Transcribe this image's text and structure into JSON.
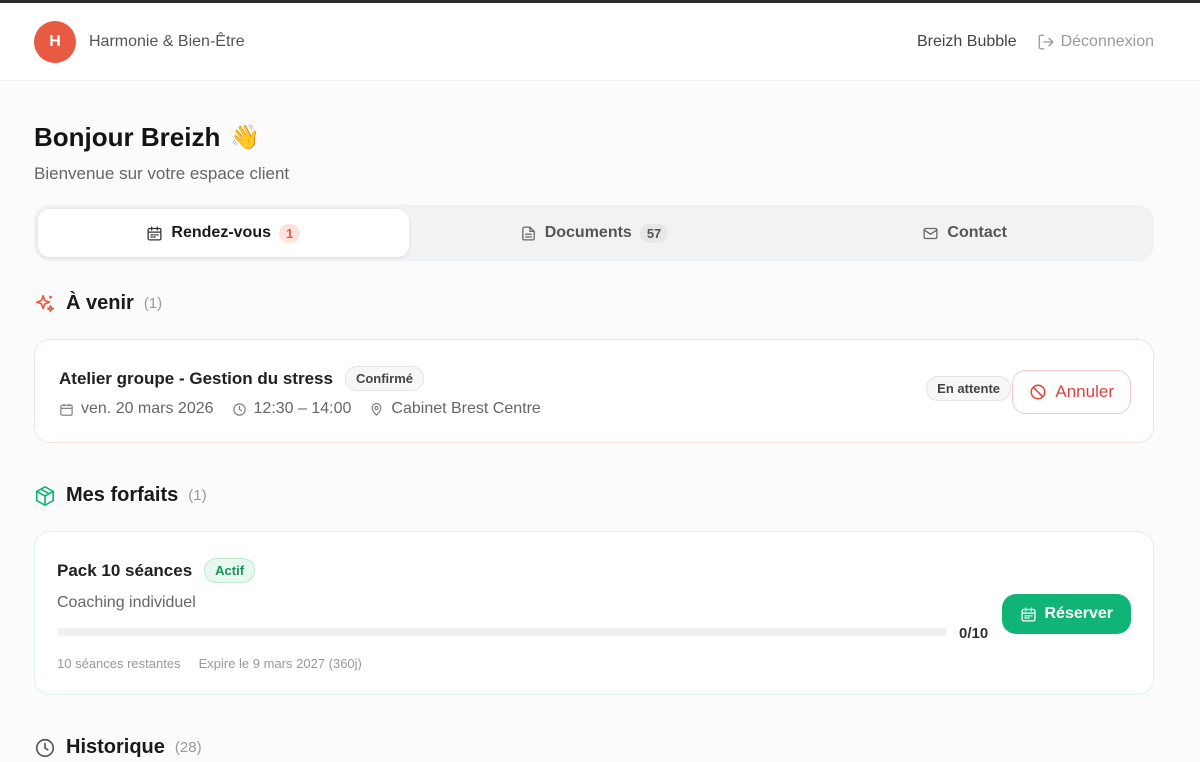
{
  "header": {
    "avatar_initial": "H",
    "brand": "Harmonie & Bien-Être",
    "username": "Breizh Bubble",
    "logout_label": "Déconnexion"
  },
  "greeting": {
    "title": "Bonjour Breizh",
    "emoji": "👋",
    "subtitle": "Bienvenue sur votre espace client"
  },
  "tabs": [
    {
      "label": "Rendez-vous",
      "count": "1",
      "active": true
    },
    {
      "label": "Documents",
      "count": "57",
      "active": false
    },
    {
      "label": "Contact",
      "count": "",
      "active": false
    }
  ],
  "upcoming": {
    "title": "À venir",
    "count": "(1)",
    "appointment": {
      "name": "Atelier groupe - Gestion du stress",
      "badge": "Confirmé",
      "date": "ven. 20 mars 2026",
      "time": "12:30 – 14:00",
      "location": "Cabinet Brest Centre",
      "status": "En attente",
      "cancel_label": "Annuler"
    }
  },
  "packages": {
    "title": "Mes forfaits",
    "count": "(1)",
    "item": {
      "name": "Pack 10 séances",
      "badge": "Actif",
      "description": "Coaching individuel",
      "progress_used": 0,
      "progress_total": 10,
      "progress_label": "0/10",
      "remaining": "10 séances restantes",
      "expiry": "Expire le 9 mars 2027 (360j)",
      "reserve_label": "Réserver"
    }
  },
  "history": {
    "title": "Historique",
    "count": "(28)"
  },
  "colors": {
    "accent": "#e95a43",
    "success": "#10b476",
    "danger": "#e0413f"
  }
}
